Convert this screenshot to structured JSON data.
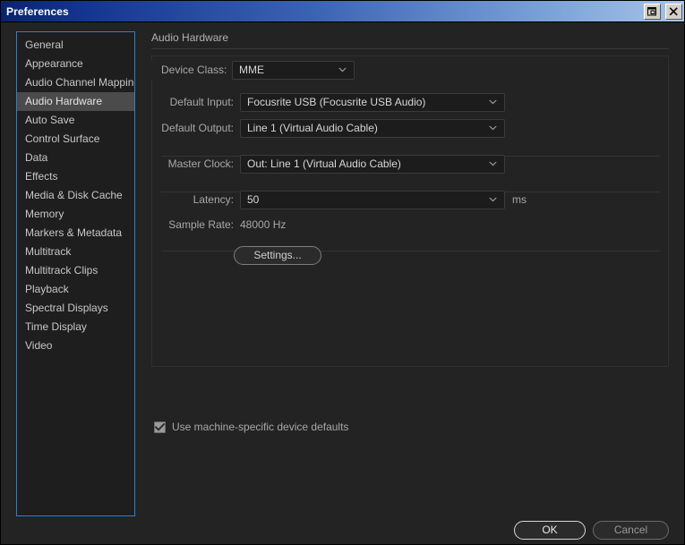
{
  "window": {
    "title": "Preferences",
    "controls": [
      {
        "name": "restore-button",
        "glyph": "restore"
      },
      {
        "name": "close-button",
        "glyph": "close"
      }
    ]
  },
  "sidebar": {
    "selected": "Audio Hardware",
    "items": [
      {
        "label": "General"
      },
      {
        "label": "Appearance"
      },
      {
        "label": "Audio Channel Mapping"
      },
      {
        "label": "Audio Hardware"
      },
      {
        "label": "Auto Save"
      },
      {
        "label": "Control Surface"
      },
      {
        "label": "Data"
      },
      {
        "label": "Effects"
      },
      {
        "label": "Media & Disk Cache"
      },
      {
        "label": "Memory"
      },
      {
        "label": "Markers & Metadata"
      },
      {
        "label": "Multitrack"
      },
      {
        "label": "Multitrack Clips"
      },
      {
        "label": "Playback"
      },
      {
        "label": "Spectral Displays"
      },
      {
        "label": "Time Display"
      },
      {
        "label": "Video"
      }
    ]
  },
  "panel": {
    "title": "Audio Hardware",
    "fields": {
      "device_class": {
        "label": "Device Class:",
        "value": "MME"
      },
      "default_input": {
        "label": "Default Input:",
        "value": "Focusrite USB (Focusrite USB Audio)"
      },
      "default_output": {
        "label": "Default Output:",
        "value": "Line 1 (Virtual Audio Cable)"
      },
      "master_clock": {
        "label": "Master Clock:",
        "value": "Out: Line 1 (Virtual Audio Cable)"
      },
      "latency": {
        "label": "Latency:",
        "value": "50",
        "unit": "ms"
      },
      "sample_rate": {
        "label": "Sample Rate:",
        "value": "48000 Hz"
      }
    },
    "settings_button": "Settings...",
    "machine_defaults": {
      "label": "Use machine-specific device defaults",
      "checked": true
    }
  },
  "footer": {
    "ok": "OK",
    "cancel": "Cancel"
  },
  "colors": {
    "dialog_bg": "#232323",
    "sidebar_bg": "#1e1e1e",
    "focus_border": "#2f7ed0",
    "selection_bg": "#4b4b4b",
    "text": "#c7c7c7",
    "label_text": "#a8a8a8",
    "field_bg": "#1c1c1c",
    "titlebar_start": "#0a246a",
    "titlebar_end": "#a7c4e8"
  }
}
